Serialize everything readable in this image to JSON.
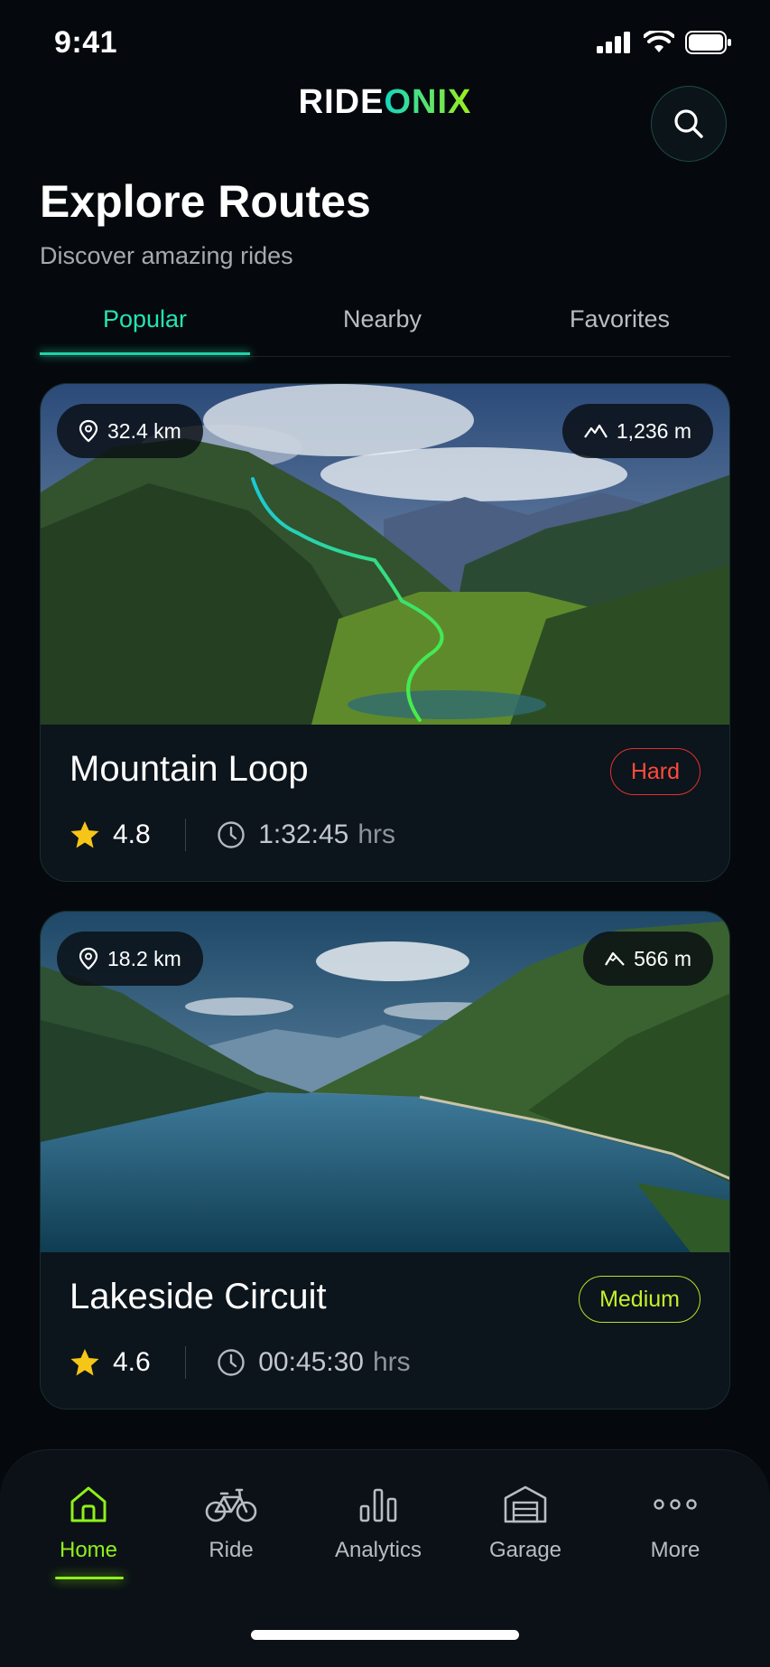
{
  "status_bar": {
    "time": "9:41"
  },
  "header": {
    "logo_primary": "RIDE",
    "logo_accent": "ONIX",
    "search_icon": "search-icon"
  },
  "page": {
    "title": "Explore Routes",
    "subtitle": "Discover amazing rides"
  },
  "tabs": [
    {
      "label": "Popular",
      "active": true
    },
    {
      "label": "Nearby",
      "active": false
    },
    {
      "label": "Favorites",
      "active": false
    }
  ],
  "routes": [
    {
      "distance": "32.4 km",
      "elevation": "1,236 m",
      "name": "Mountain Loop",
      "difficulty": "Hard",
      "rating": "4.8",
      "duration": "1:32:45",
      "duration_unit": "hrs"
    },
    {
      "distance": "18.2 km",
      "elevation": "566 m",
      "name": "Lakeside Circuit",
      "difficulty": "Medium",
      "rating": "4.6",
      "duration": "00:45:30",
      "duration_unit": "hrs"
    }
  ],
  "bottom_nav": [
    {
      "label": "Home",
      "icon": "home-icon",
      "active": true
    },
    {
      "label": "Ride",
      "icon": "bicycle-icon",
      "active": false
    },
    {
      "label": "Analytics",
      "icon": "bar-chart-icon",
      "active": false
    },
    {
      "label": "Garage",
      "icon": "garage-icon",
      "active": false
    },
    {
      "label": "More",
      "icon": "more-dots-icon",
      "active": false
    }
  ],
  "colors": {
    "background": "#05090d",
    "accent_teal": "#26e3b0",
    "accent_lime": "#8ef01a",
    "hard": "#ff4a3d",
    "medium": "#c6f02a",
    "star": "#f5c518"
  }
}
